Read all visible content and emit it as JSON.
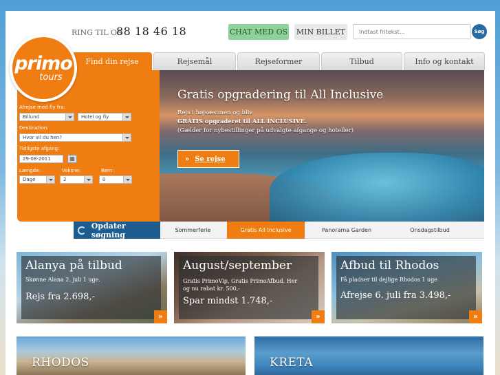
{
  "brand": {
    "logo_main": "primo",
    "logo_sub": "tours"
  },
  "header": {
    "phone_label": "RING TIL OS",
    "phone_number": "88 18 46 18",
    "chat_label": "CHAT MED OS",
    "ticket_label": "MIN BILLET",
    "search_placeholder": "Indtast fritekst...",
    "search_button": "Søg"
  },
  "nav": {
    "tabs": [
      "Find din rejse",
      "Rejsemål",
      "Rejseformer",
      "Tilbud",
      "Info og kontakt"
    ],
    "active": "Find din rejse"
  },
  "search_form": {
    "departure_label": "Afrejse med fly fra:",
    "departure_value": "Billund",
    "type_value": "Hotel og fly",
    "destination_label": "Destination:",
    "destination_value": "Hvor vil du hen?",
    "date_label": "Tidligste afgang:",
    "date_value": "29-08-2011",
    "length_label": "Længde:",
    "length_value": "Dage",
    "adults_label": "Voksne:",
    "adults_value": "2",
    "children_label": "Børn:",
    "children_value": "0",
    "update_label": "Opdater søgning"
  },
  "hero": {
    "title": "Gratis opgradering til All Inclusive",
    "line1": "Rejs i højsæsonen og bliv",
    "line2": "GRATIS opgraderet til ALL INCLUSIVE.",
    "line3": "(Gælder for nybestillinger på udvalgte afgange og hoteller)",
    "button": "Se rejse"
  },
  "carousel_tabs": [
    "Sommerferie",
    "Gratis All Inclusive",
    "Panorama Garden",
    "Onsdagstilbud"
  ],
  "carousel_active": "Gratis All Inclusive",
  "cards": [
    {
      "title": "Alanya på tilbud",
      "text1": "Skønne Alana 2. juli 1 uge.",
      "text2": "",
      "price": "Rejs fra 2.698,-"
    },
    {
      "title": "August/september",
      "text1": "Gratis PrimoVip, Gratis PrimoAfbud. Her",
      "text2": "og nu rabat kr. 500,-",
      "price": "Spar mindst 1.748,-"
    },
    {
      "title": "Afbud til Rhodos",
      "text1": "Få pladser til dejlige Rhodos 1 uge",
      "text2": "",
      "price": "Afrejse 6. juli fra 3.498,-"
    }
  ],
  "bottom_banners": [
    "RHODOS",
    "KRETA"
  ]
}
